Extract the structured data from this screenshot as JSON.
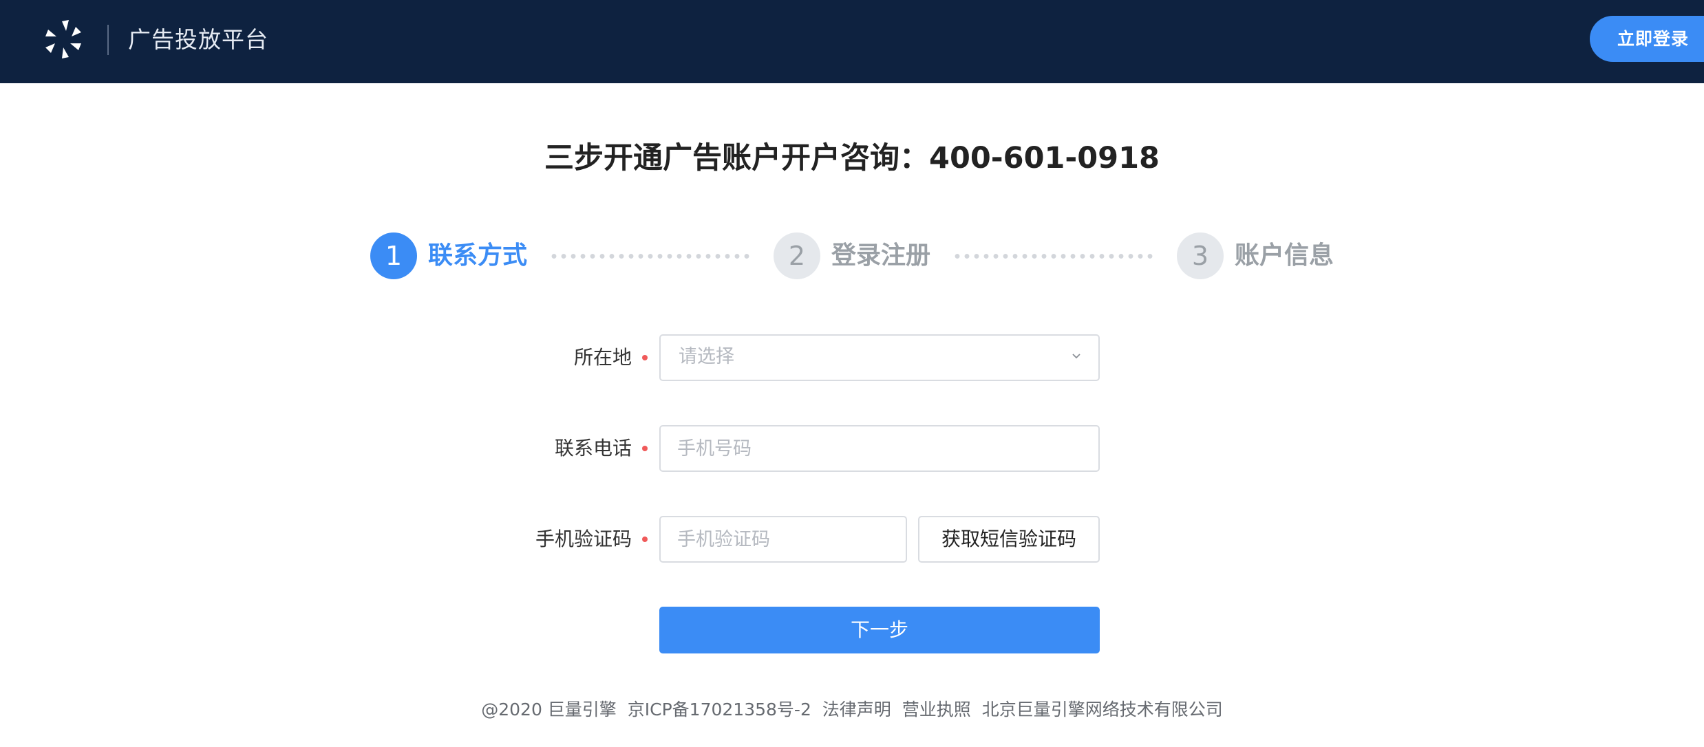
{
  "header": {
    "brand": "广告投放平台",
    "login_button": "立即登录",
    "logo_icon": "pinwheel-logo-icon",
    "background_color": "#0e2240",
    "accent_color": "#3b8cf5"
  },
  "main": {
    "title": "三步开通广告账户开户咨询：400-601-0918",
    "steps": [
      {
        "number": "1",
        "label": "联系方式",
        "state": "active"
      },
      {
        "number": "2",
        "label": "登录注册",
        "state": "inactive"
      },
      {
        "number": "3",
        "label": "账户信息",
        "state": "inactive"
      }
    ],
    "form": {
      "location": {
        "label": "所在地",
        "placeholder": "请选择",
        "required": true
      },
      "phone": {
        "label": "联系电话",
        "placeholder": "手机号码",
        "value": "",
        "required": true
      },
      "code": {
        "label": "手机验证码",
        "placeholder": "手机验证码",
        "value": "",
        "required": true
      },
      "sms_button": "获取短信验证码",
      "next_button": "下一步"
    }
  },
  "footer": {
    "copyright": "@2020 巨量引擎",
    "icp": "京ICP备17021358号-2",
    "legal": "法律声明",
    "license": "营业执照",
    "company": "北京巨量引擎网络技术有限公司"
  }
}
